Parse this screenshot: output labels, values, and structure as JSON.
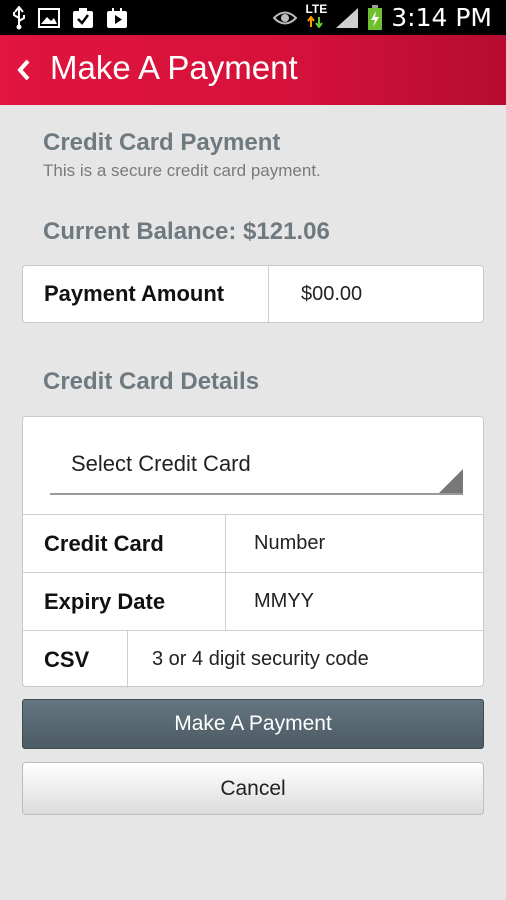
{
  "status_bar": {
    "network": "LTE",
    "time": "3:14 PM"
  },
  "app_bar": {
    "title": "Make A Payment"
  },
  "payment": {
    "section_title": "Credit Card Payment",
    "subtitle": "This is a secure credit card payment.",
    "balance": "Current Balance: $121.06",
    "amount_label": "Payment Amount",
    "amount_value": "$00.00"
  },
  "card_details": {
    "section_title": "Credit Card Details",
    "select_label": "Select Credit Card",
    "card_number_label": "Credit Card",
    "card_number_placeholder": "Number",
    "expiry_label": "Expiry Date",
    "expiry_placeholder": "MMYY",
    "csv_label": "CSV",
    "csv_placeholder": "3 or 4 digit security code"
  },
  "actions": {
    "primary_label": "Make A Payment",
    "cancel_label": "Cancel"
  },
  "colors": {
    "accent": "#d4113a",
    "section_text": "#6f7a80",
    "primary_button": "#56656e"
  }
}
